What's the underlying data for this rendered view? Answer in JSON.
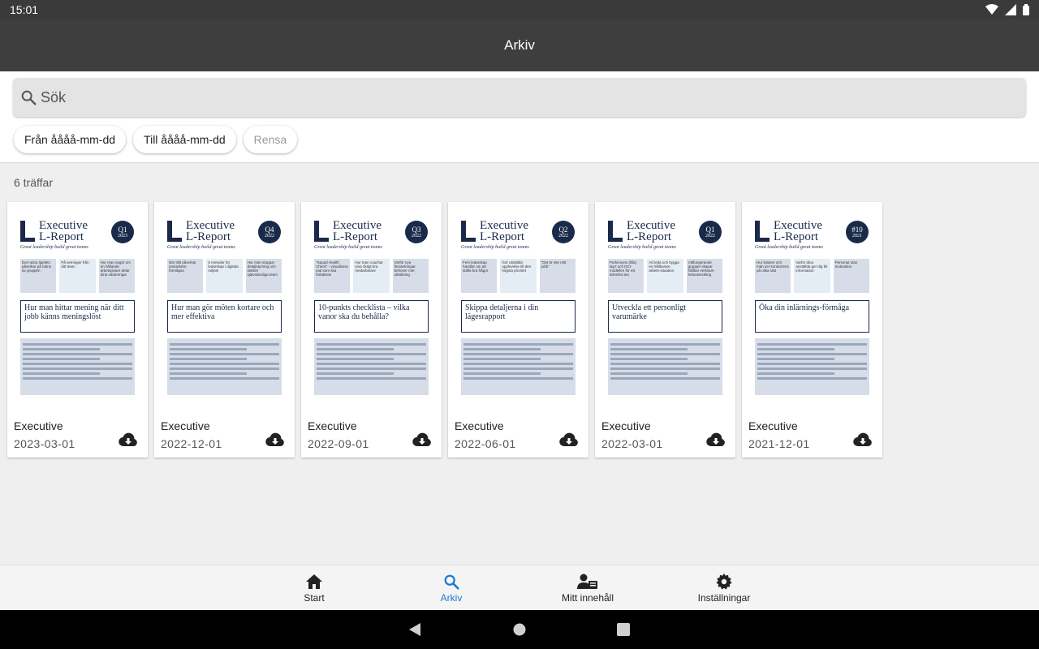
{
  "status_bar": {
    "time": "15:01",
    "icons": [
      "wifi-icon",
      "signal-icon",
      "battery-icon"
    ]
  },
  "app_bar": {
    "title": "Arkiv"
  },
  "search": {
    "placeholder": "Sök",
    "value": "",
    "icon": "search-icon"
  },
  "filters": {
    "from_label": "Från åååå-mm-dd",
    "to_label": "Till åååå-mm-dd",
    "clear_label": "Rensa"
  },
  "results": {
    "count_label": "6 träffar",
    "items": [
      {
        "title": "Executive",
        "date": "2023-03-01",
        "cover": {
          "masthead_line1": "Executive",
          "masthead_line2": "L-Report",
          "tagline": "Great leadership build great teams",
          "issue": "Q1",
          "year": "2023",
          "teasers": [
            "Det rutina lipplets påverkar på rutins av gruppen",
            "På seminger från ditt team",
            "Hur man avgör om en hållande arbetsgivare delar dina värderingar"
          ],
          "headline": "Hur man hittar mening när ditt jobb känns meningslöst"
        }
      },
      {
        "title": "Executive",
        "date": "2022-12-01",
        "cover": {
          "masthead_line1": "Executive",
          "masthead_line2": "L-Report",
          "tagline": "Great leadership build great teams",
          "issue": "Q4",
          "year": "2022",
          "teasers": [
            "När tillit påverkar samarbets-förmågan",
            "5 metoder för ledarskap i digitala miljöer",
            "Hur man stoppar detaljstyrning och stärker självständiga team"
          ],
          "headline": "Hur man gör möten kortare och mer effektiva"
        }
      },
      {
        "title": "Executive",
        "date": "2022-09-01",
        "cover": {
          "masthead_line1": "Executive",
          "masthead_line2": "L-Report",
          "tagline": "Great leadership build great teams",
          "issue": "Q3",
          "year": "2022",
          "teasers": [
            "\"Squad Health Check\" - visualisera vad som ska förbättras",
            "Hur man coachar sina riktigt bra medarbetare",
            "Varför nya förväntningar behöver mer utbildning"
          ],
          "headline": "10-punkts checklista – vilka vanor ska du behålla?"
        }
      },
      {
        "title": "Executive",
        "date": "2022-06-01",
        "cover": {
          "masthead_line1": "Executive",
          "masthead_line2": "L-Report",
          "tagline": "Great leadership build great teams",
          "issue": "Q2",
          "year": "2022",
          "teasers": [
            "Fem ledarskap handlar om att ställa bra frågor",
            "Gör utställda upplevelse till den högsta prioritet",
            "\"Det är inte mitt jobb\""
          ],
          "headline": "Skippa detaljerna i din lägesrapport"
        }
      },
      {
        "title": "Executive",
        "date": "2022-03-01",
        "cover": {
          "masthead_line1": "Executive",
          "masthead_line2": "L-Report",
          "tagline": "Great leadership build great teams",
          "issue": "Q1",
          "year": "2022",
          "teasers": [
            "Parkinsons (lilla) lag? och DCI-modellen för ett ärtverka tea",
            "Att leda och bygga en hållbarare arbets-situation",
            "Välfungerande grupper skapar hållbar verksam-hetsutveckling"
          ],
          "headline": "Utveckla ett personligt varumärke"
        }
      },
      {
        "title": "Executive",
        "date": "2021-12-01",
        "cover": {
          "masthead_line1": "Executive",
          "masthead_line2": "L-Report",
          "tagline": "Great leadership build great teams",
          "issue": "#10",
          "year": "2021",
          "teasers": [
            "Hur ledarer och män ser konkurrens på olika sätt",
            "Varför dina anställda ger dig fel information",
            "Personal utan motivation"
          ],
          "headline": "Öka din inlärnings-förmåga"
        }
      }
    ]
  },
  "bottom_nav": {
    "items": [
      {
        "label": "Start",
        "icon": "home-icon"
      },
      {
        "label": "Arkiv",
        "icon": "search-icon",
        "active": true
      },
      {
        "label": "Mitt innehåll",
        "icon": "account-box-icon"
      },
      {
        "label": "Inställningar",
        "icon": "gear-icon"
      }
    ]
  },
  "colors": {
    "app_bar": "#3e3e3e",
    "accent": "#1976d2",
    "cover_navy": "#1a2a4a"
  }
}
